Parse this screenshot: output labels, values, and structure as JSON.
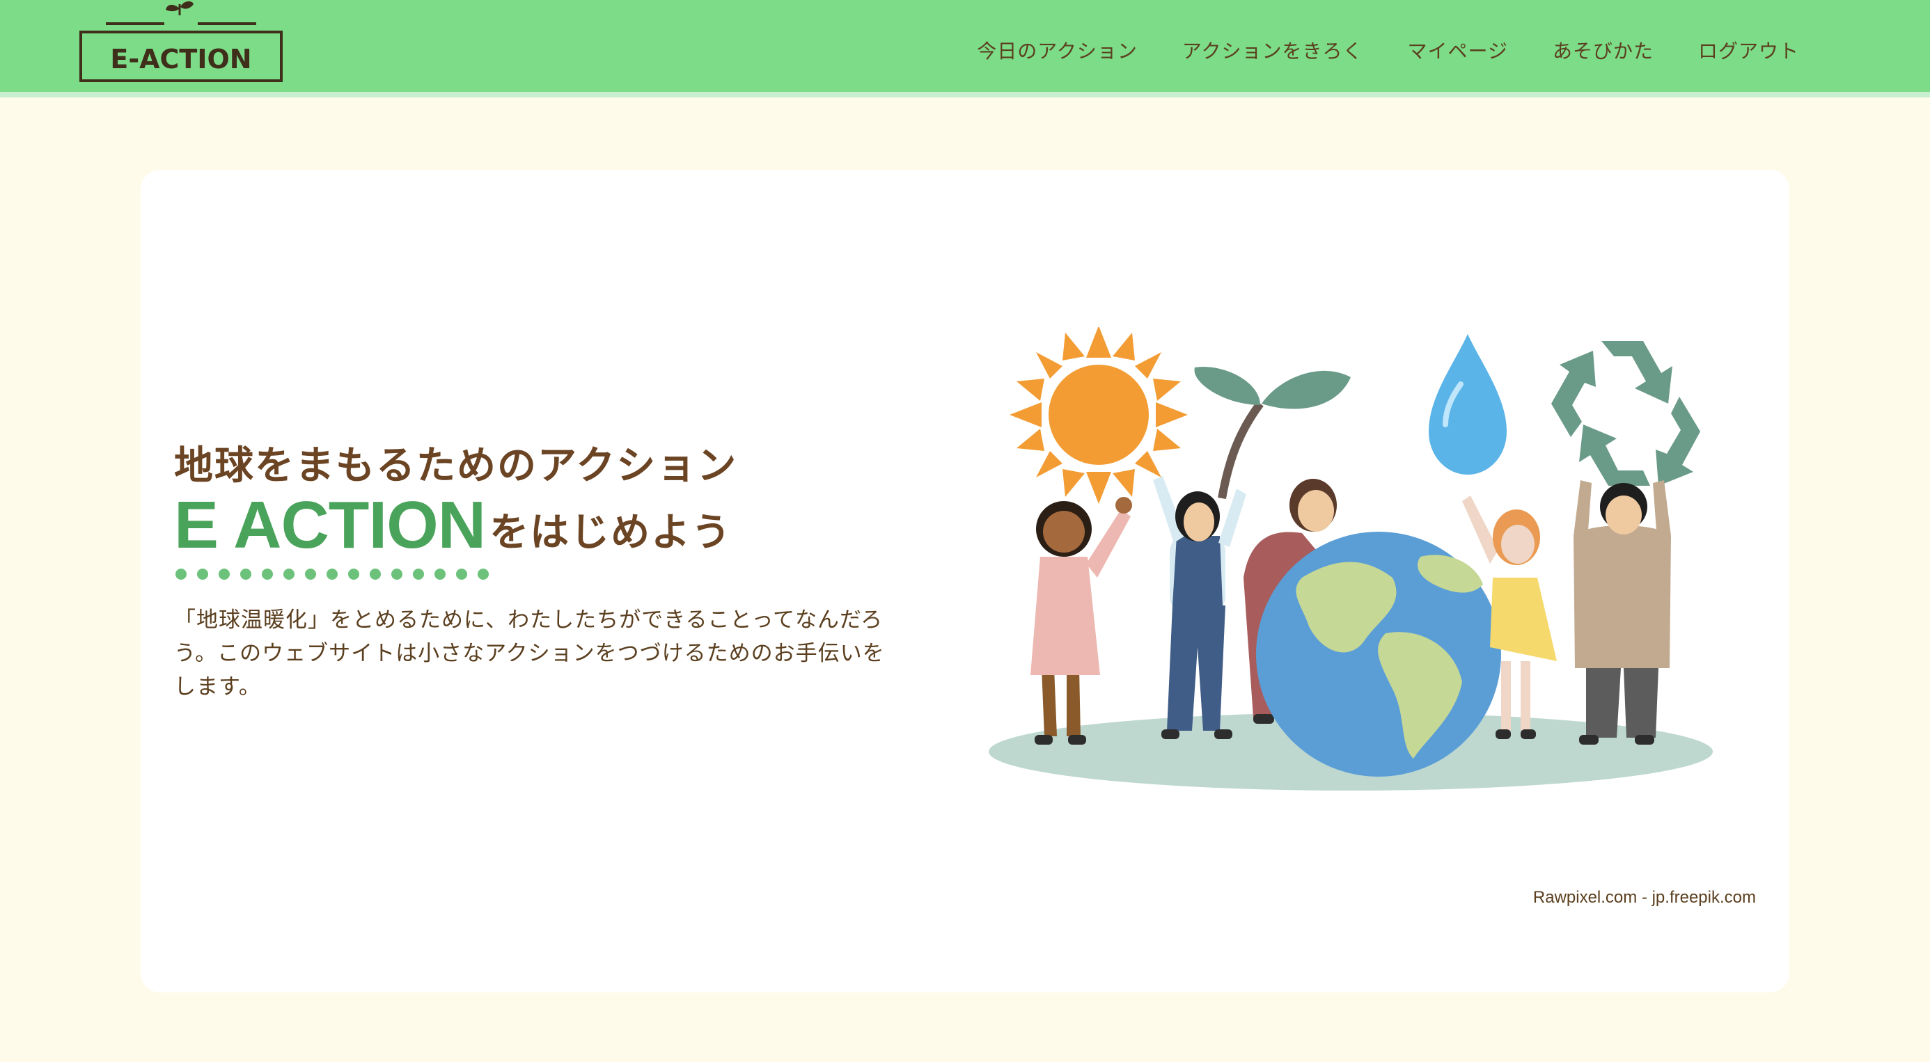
{
  "header": {
    "logo_text": "E-ACTION",
    "nav": [
      {
        "label": "今日のアクション"
      },
      {
        "label": "アクションをきろく"
      },
      {
        "label": "マイページ"
      },
      {
        "label": "あそびかた"
      },
      {
        "label": "ログアウト"
      }
    ]
  },
  "hero": {
    "headline_line1": "地球をまもるためのアクション",
    "brand": "E ACTION",
    "headline_suffix": "をはじめよう",
    "description": "「地球温暖化」をとめるために、わたしたちができることってなんだろう。このウェブサイトは小さなアクションをつづけるためのお手伝いをします。",
    "dot_count": 15
  },
  "illustration": {
    "icons": [
      "sun-icon",
      "leaf-icon",
      "water-drop-icon",
      "recycle-icon",
      "globe-icon"
    ]
  },
  "credit": "Rawpixel.com - jp.freepik.com",
  "colors": {
    "header_bg": "#7cdc88",
    "page_bg": "#fffbea",
    "brand_green": "#4aa35a",
    "text_brown": "#6b4423"
  }
}
